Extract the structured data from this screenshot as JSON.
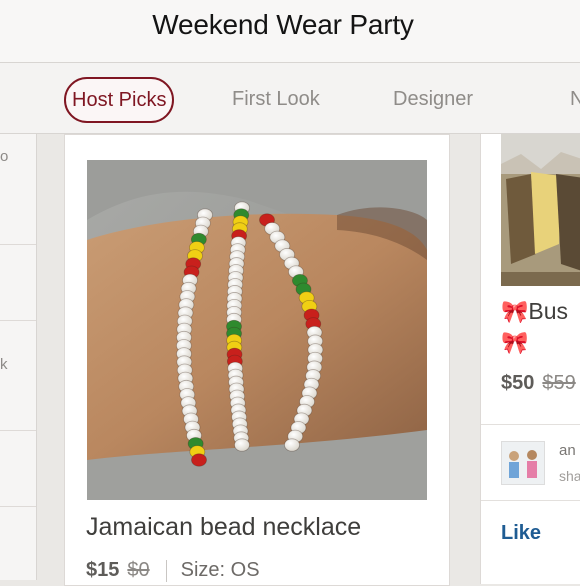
{
  "header": {
    "title": "Weekend Wear Party"
  },
  "tabs": [
    {
      "label": "Host Picks",
      "active": true
    },
    {
      "label": "First Look",
      "active": false
    },
    {
      "label": "Designer",
      "active": false
    },
    {
      "label": "N",
      "active": false
    }
  ],
  "left_panel": {
    "fragments": [
      "o",
      "k"
    ]
  },
  "listing": {
    "title": "Jamaican bead necklace",
    "price": "$15",
    "original_price": "$0",
    "size": "Size: OS"
  },
  "listing2": {
    "title_line1": "Bus",
    "price": "$50",
    "original_price": "$59",
    "user_name": "an",
    "user_action": "sha",
    "like_label": "Like",
    "bow_icon": "ribbon-bow-icon"
  },
  "colors": {
    "accent": "#7f1622",
    "link": "#1f5c93",
    "bead_white": "#f4f1ea",
    "bead_red": "#c8201c",
    "bead_yellow": "#f0cf14",
    "bead_green": "#2f8a2e"
  }
}
